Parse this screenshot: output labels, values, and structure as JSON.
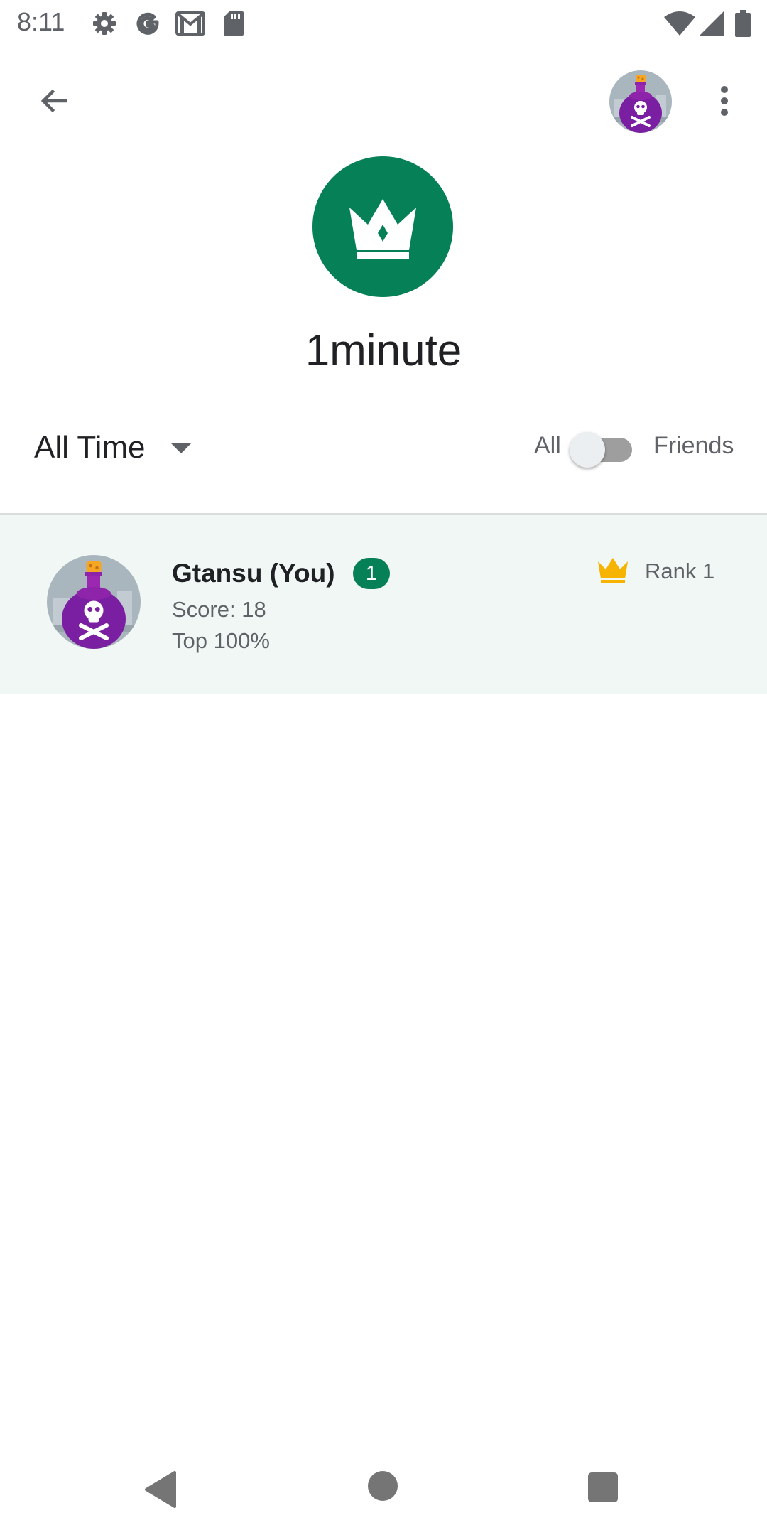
{
  "status_bar": {
    "time": "8:11",
    "icons": [
      "settings-icon",
      "google-icon",
      "gmail-icon",
      "sd-card-icon",
      "wifi-icon",
      "signal-icon",
      "battery-icon"
    ]
  },
  "app_bar": {
    "back_icon": "arrow-back-icon",
    "avatar_icon": "poison-bottle-avatar",
    "menu_icon": "more-vert-icon"
  },
  "header": {
    "icon": "crown-icon",
    "title": "1minute"
  },
  "filters": {
    "time_range": "All Time",
    "toggle_left_label": "All",
    "toggle_right_label": "Friends",
    "friends_only": false
  },
  "entries": [
    {
      "name": "Gtansu (You)",
      "badge": "1",
      "score": "Score: 18",
      "percentile": "Top 100%",
      "rank": "Rank 1"
    }
  ],
  "colors": {
    "accent": "#068057",
    "highlight_row": "#f1f7f5",
    "crown_gold": "#f6b400",
    "avatar_purple": "#7b1fa2"
  },
  "nav_bar": {
    "icons": [
      "nav-back-icon",
      "nav-home-icon",
      "nav-recents-icon"
    ]
  }
}
